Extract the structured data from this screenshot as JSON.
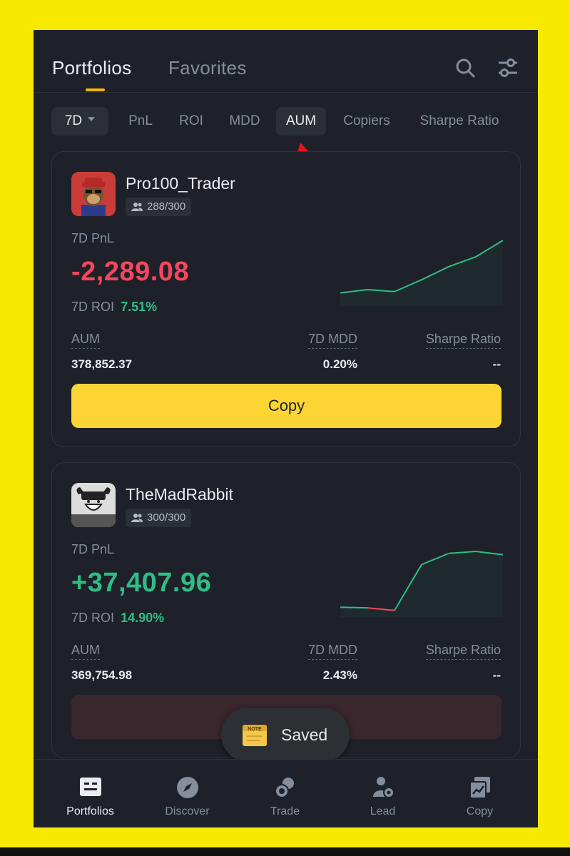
{
  "header": {
    "tabs": [
      {
        "label": "Portfolios",
        "active": true
      },
      {
        "label": "Favorites",
        "active": false
      }
    ],
    "icons": [
      "search-icon",
      "filter-sliders-icon"
    ]
  },
  "filters": {
    "period": "7D",
    "sort_options": [
      "PnL",
      "ROI",
      "MDD",
      "AUM",
      "Copiers",
      "Sharpe Ratio"
    ],
    "active_sort": "AUM"
  },
  "cards": [
    {
      "name": "Pro100_Trader",
      "copiers": "288/300",
      "pnl_label": "7D PnL",
      "pnl_value": "-2,289.08",
      "roi_period": "7D",
      "roi_label": "ROI",
      "roi_value": "7.51%",
      "aum_label": "AUM",
      "aum_value": "378,852.37",
      "mdd_label": "7D MDD",
      "mdd_value": "0.20%",
      "sharpe_label": "Sharpe Ratio",
      "sharpe_value": "--",
      "copy_label": "Copy",
      "sparkline": [
        0.2,
        0.25,
        0.22,
        0.4,
        0.6,
        0.75,
        1.0
      ]
    },
    {
      "name": "TheMadRabbit",
      "copiers": "300/300",
      "pnl_label": "7D PnL",
      "pnl_value": "+37,407.96",
      "roi_period": "7D",
      "roi_label": "ROI",
      "roi_value": "14.90%",
      "aum_label": "AUM",
      "aum_value": "369,754.98",
      "mdd_label": "7D MDD",
      "mdd_value": "2.43%",
      "sharpe_label": "Sharpe Ratio",
      "sharpe_value": "--",
      "copy_label": "",
      "sparkline": [
        0.15,
        0.14,
        0.1,
        0.8,
        0.97,
        1.0,
        0.95
      ]
    }
  ],
  "toast": {
    "text": "Saved",
    "icon": "note-icon"
  },
  "bottom_nav": [
    {
      "label": "Portfolios",
      "icon": "portfolios-icon",
      "active": true
    },
    {
      "label": "Discover",
      "icon": "compass-icon",
      "active": false
    },
    {
      "label": "Trade",
      "icon": "trade-icon",
      "active": false
    },
    {
      "label": "Lead",
      "icon": "lead-icon",
      "active": false
    },
    {
      "label": "Copy",
      "icon": "copy-icon",
      "active": false
    }
  ],
  "colors": {
    "accent": "#fcd535",
    "positive": "#2ebd85",
    "negative": "#f6465d",
    "background": "#1e2129",
    "frame": "#f7ea00",
    "annotation_arrow": "#e8141b"
  }
}
